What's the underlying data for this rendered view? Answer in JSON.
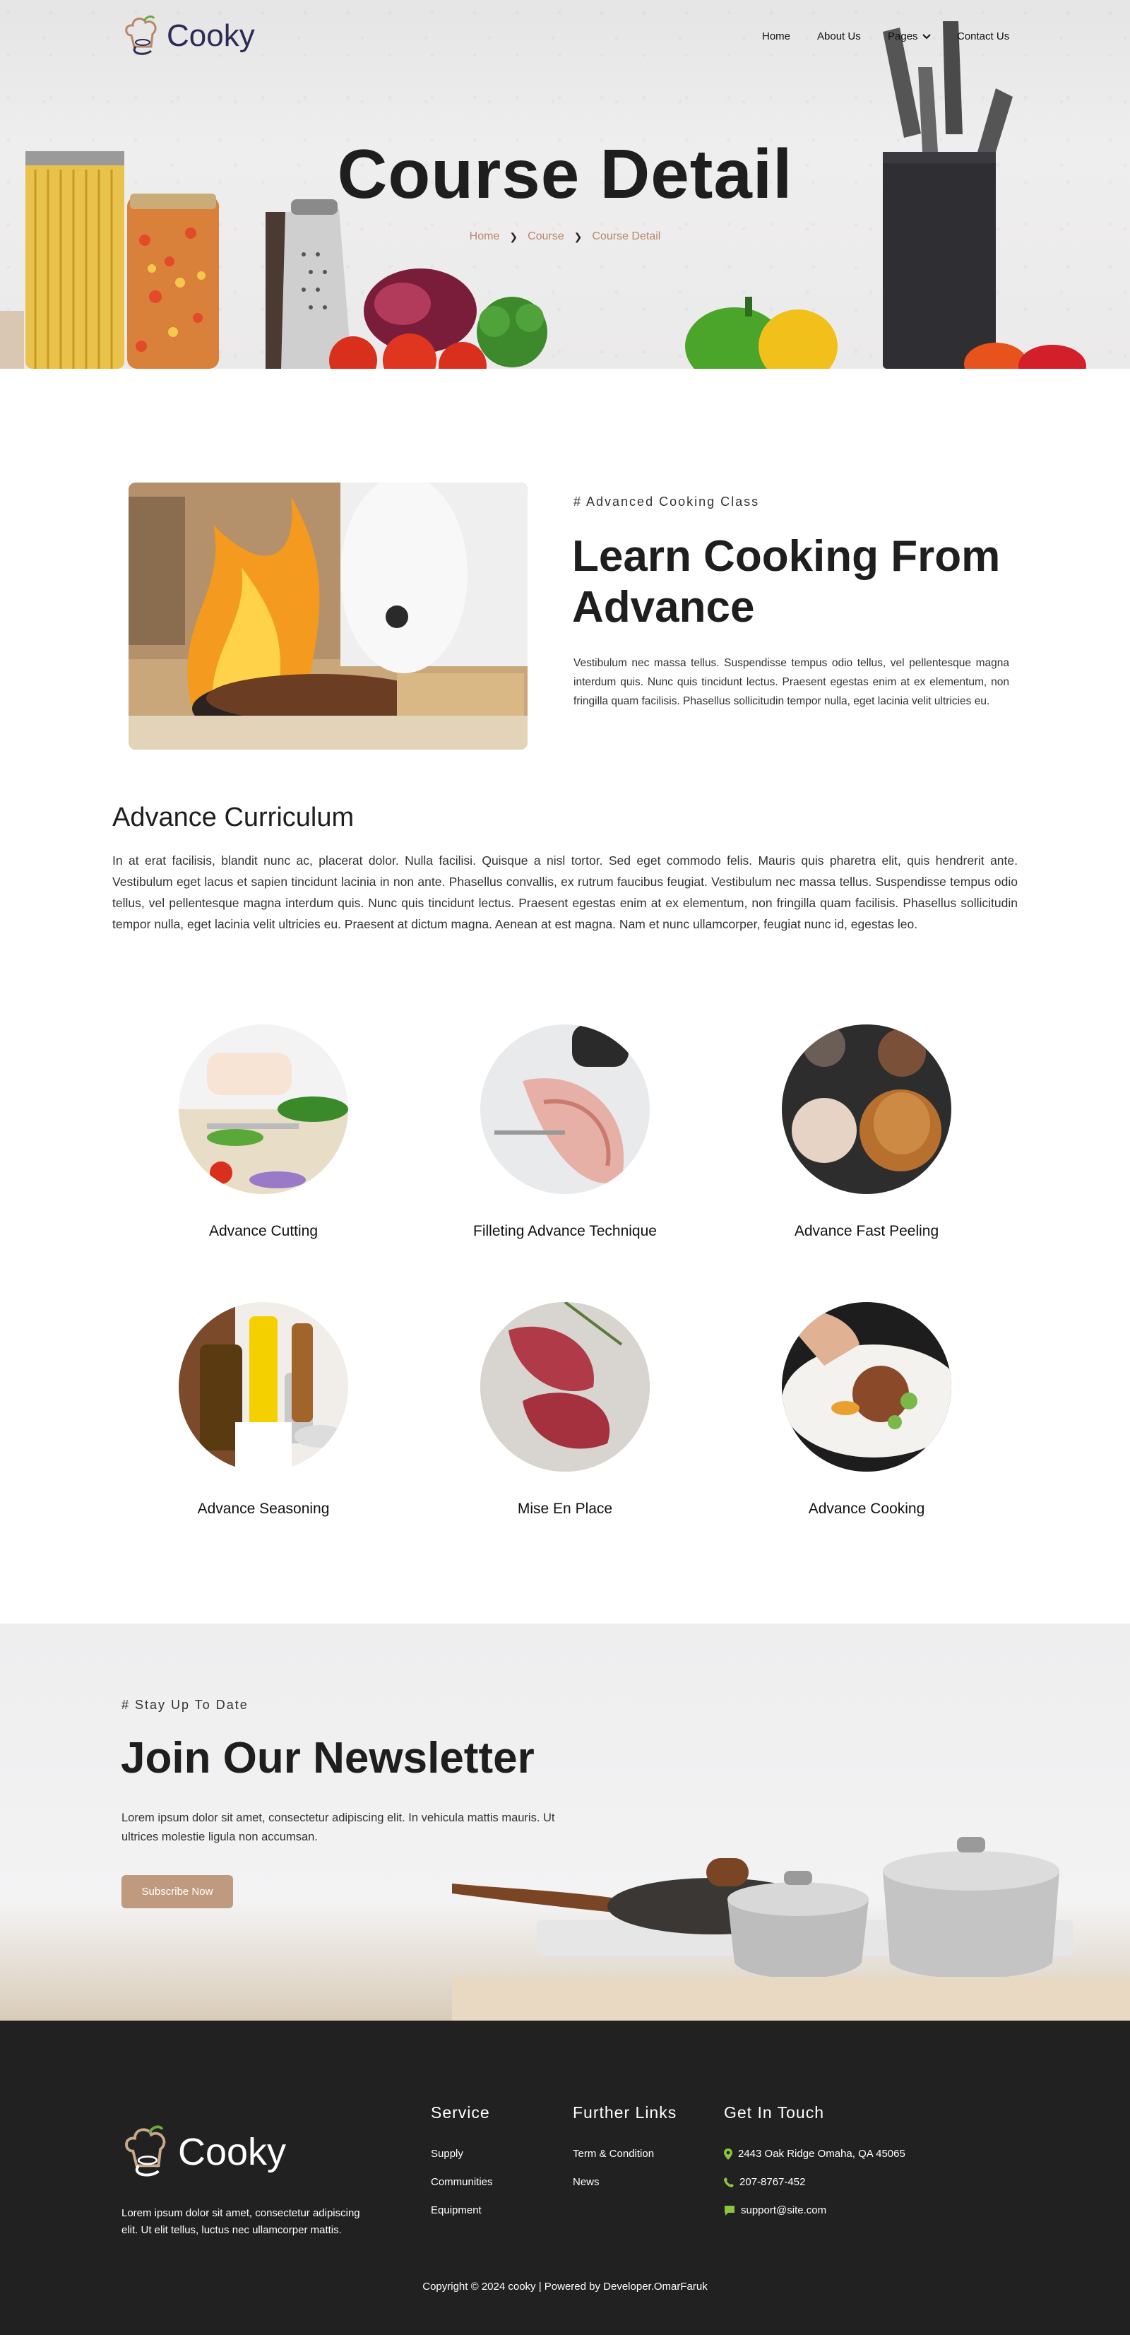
{
  "brand": {
    "name": "Cooky"
  },
  "nav": {
    "items": [
      {
        "label": "Home"
      },
      {
        "label": "About Us"
      },
      {
        "label": "Pages"
      },
      {
        "label": "Contact Us"
      }
    ]
  },
  "hero": {
    "title": "Course Detail",
    "breadcrumb": [
      "Home",
      "Course",
      "Course Detail"
    ]
  },
  "intro": {
    "eyebrow": "# Advanced Cooking Class",
    "title_line1": "Learn Cooking From",
    "title_line2": "Advance",
    "text": "Vestibulum nec massa tellus. Suspendisse tempus odio tellus, vel pellentesque magna interdum quis. Nunc quis tincidunt lectus. Praesent egestas enim at ex elementum, non fringilla quam facilisis. Phasellus sollicitudin tempor nulla, eget lacinia velit ultricies eu."
  },
  "curriculum": {
    "title": "Advance Curriculum",
    "text": "In at erat facilisis, blandit nunc ac, placerat dolor. Nulla facilisi. Quisque a nisl tortor. Sed eget commodo felis. Mauris quis pharetra elit, quis hendrerit ante. Vestibulum eget lacus et sapien tincidunt lacinia in non ante. Phasellus convallis, ex rutrum faucibus feugiat. Vestibulum nec massa tellus. Suspendisse tempus odio tellus, vel pellentesque magna interdum quis. Nunc quis tincidunt lectus. Praesent egestas enim at ex elementum, non fringilla quam facilisis. Phasellus sollicitudin tempor nulla, eget lacinia velit ultricies eu. Praesent at dictum magna. Aenean at est magna. Nam et nunc ullamcorper, feugiat nunc id, egestas leo.",
    "items": [
      {
        "label": "Advance Cutting"
      },
      {
        "label": "Filleting Advance Technique"
      },
      {
        "label": "Advance Fast Peeling"
      },
      {
        "label": "Advance Seasoning"
      },
      {
        "label": "Mise En Place"
      },
      {
        "label": "Advance Cooking"
      }
    ]
  },
  "newsletter": {
    "eyebrow": "# Stay Up To Date",
    "title": "Join Our Newsletter",
    "text_line1": "Lorem ipsum dolor sit amet, consectetur adipiscing elit. In vehicula mattis mauris. Ut",
    "text_line2": "ultrices molestie ligula non accumsan.",
    "button": "Subscribe Now"
  },
  "footer": {
    "about_line1": "Lorem ipsum dolor sit amet, consectetur adipiscing",
    "about_line2": "elit. Ut elit tellus, luctus nec ullamcorper mattis.",
    "service": {
      "title": "Service",
      "links": [
        "Supply",
        "Communities",
        "Equipment"
      ]
    },
    "further": {
      "title": "Further Links",
      "links": [
        "Term & Condition",
        "News"
      ]
    },
    "contact": {
      "title": "Get In Touch",
      "address": "2443 Oak Ridge Omaha, QA 45065",
      "phone": "207-8767-452",
      "email": "support@site.com"
    },
    "copyright": "Copyright © 2024 cooky | Powered by Developer.OmarFaruk"
  },
  "colors": {
    "accent": "#c09a7f",
    "breadcrumb": "#b7876b",
    "icon_green": "#8cc63f",
    "dark": "#212121"
  }
}
